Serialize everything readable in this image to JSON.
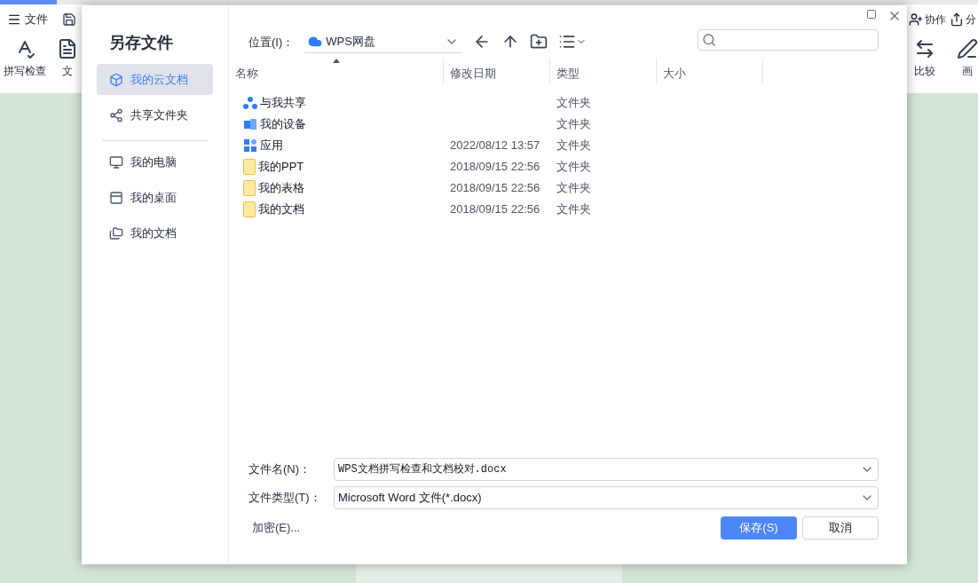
{
  "app": {
    "menu_label": "文件",
    "ribbon_left": [
      {
        "label": "拼写检查",
        "kind": "spell"
      },
      {
        "label": "文",
        "kind": "doc"
      }
    ],
    "ribbon_right": [
      {
        "label": "比较",
        "kind": "compare"
      },
      {
        "label": "画",
        "kind": "pen"
      }
    ],
    "top_right": [
      {
        "label": "协作",
        "kind": "collab"
      },
      {
        "label": "分",
        "kind": "share"
      }
    ]
  },
  "dialog": {
    "title": "另存文件",
    "sidebar": [
      {
        "label": "我的云文档",
        "kind": "cloud",
        "selected": true
      },
      {
        "label": "共享文件夹",
        "kind": "shared",
        "selected": false
      },
      {
        "label": "我的电脑",
        "kind": "pc",
        "selected": false,
        "divider_before": true
      },
      {
        "label": "我的桌面",
        "kind": "desktop",
        "selected": false
      },
      {
        "label": "我的文档",
        "kind": "docs",
        "selected": false
      }
    ],
    "location_label": "位置(I)：",
    "location": "WPS网盘",
    "columns": [
      "名称",
      "修改日期",
      "类型",
      "大小"
    ],
    "rows": [
      {
        "name": "与我共享",
        "date": "",
        "type": "文件夹",
        "kind": "share"
      },
      {
        "name": "我的设备",
        "date": "",
        "type": "文件夹",
        "kind": "device"
      },
      {
        "name": "应用",
        "date": "2022/08/12 13:57",
        "type": "文件夹",
        "kind": "apps"
      },
      {
        "name": "我的PPT",
        "date": "2018/09/15 22:56",
        "type": "文件夹",
        "kind": "folder"
      },
      {
        "name": "我的表格",
        "date": "2018/09/15 22:56",
        "type": "文件夹",
        "kind": "folder"
      },
      {
        "name": "我的文档",
        "date": "2018/09/15 22:56",
        "type": "文件夹",
        "kind": "folder"
      }
    ],
    "filename_label": "文件名(N)：",
    "filename": "WPS文档拼写检查和文档校对.docx",
    "filetype_label": "文件类型(T)：",
    "filetype": "Microsoft Word 文件(*.docx)",
    "encrypt_link": "加密(E)...",
    "buttons": [
      {
        "label": "保存(S)",
        "kind": "primary"
      },
      {
        "label": "取消",
        "kind": "secondary"
      }
    ]
  }
}
